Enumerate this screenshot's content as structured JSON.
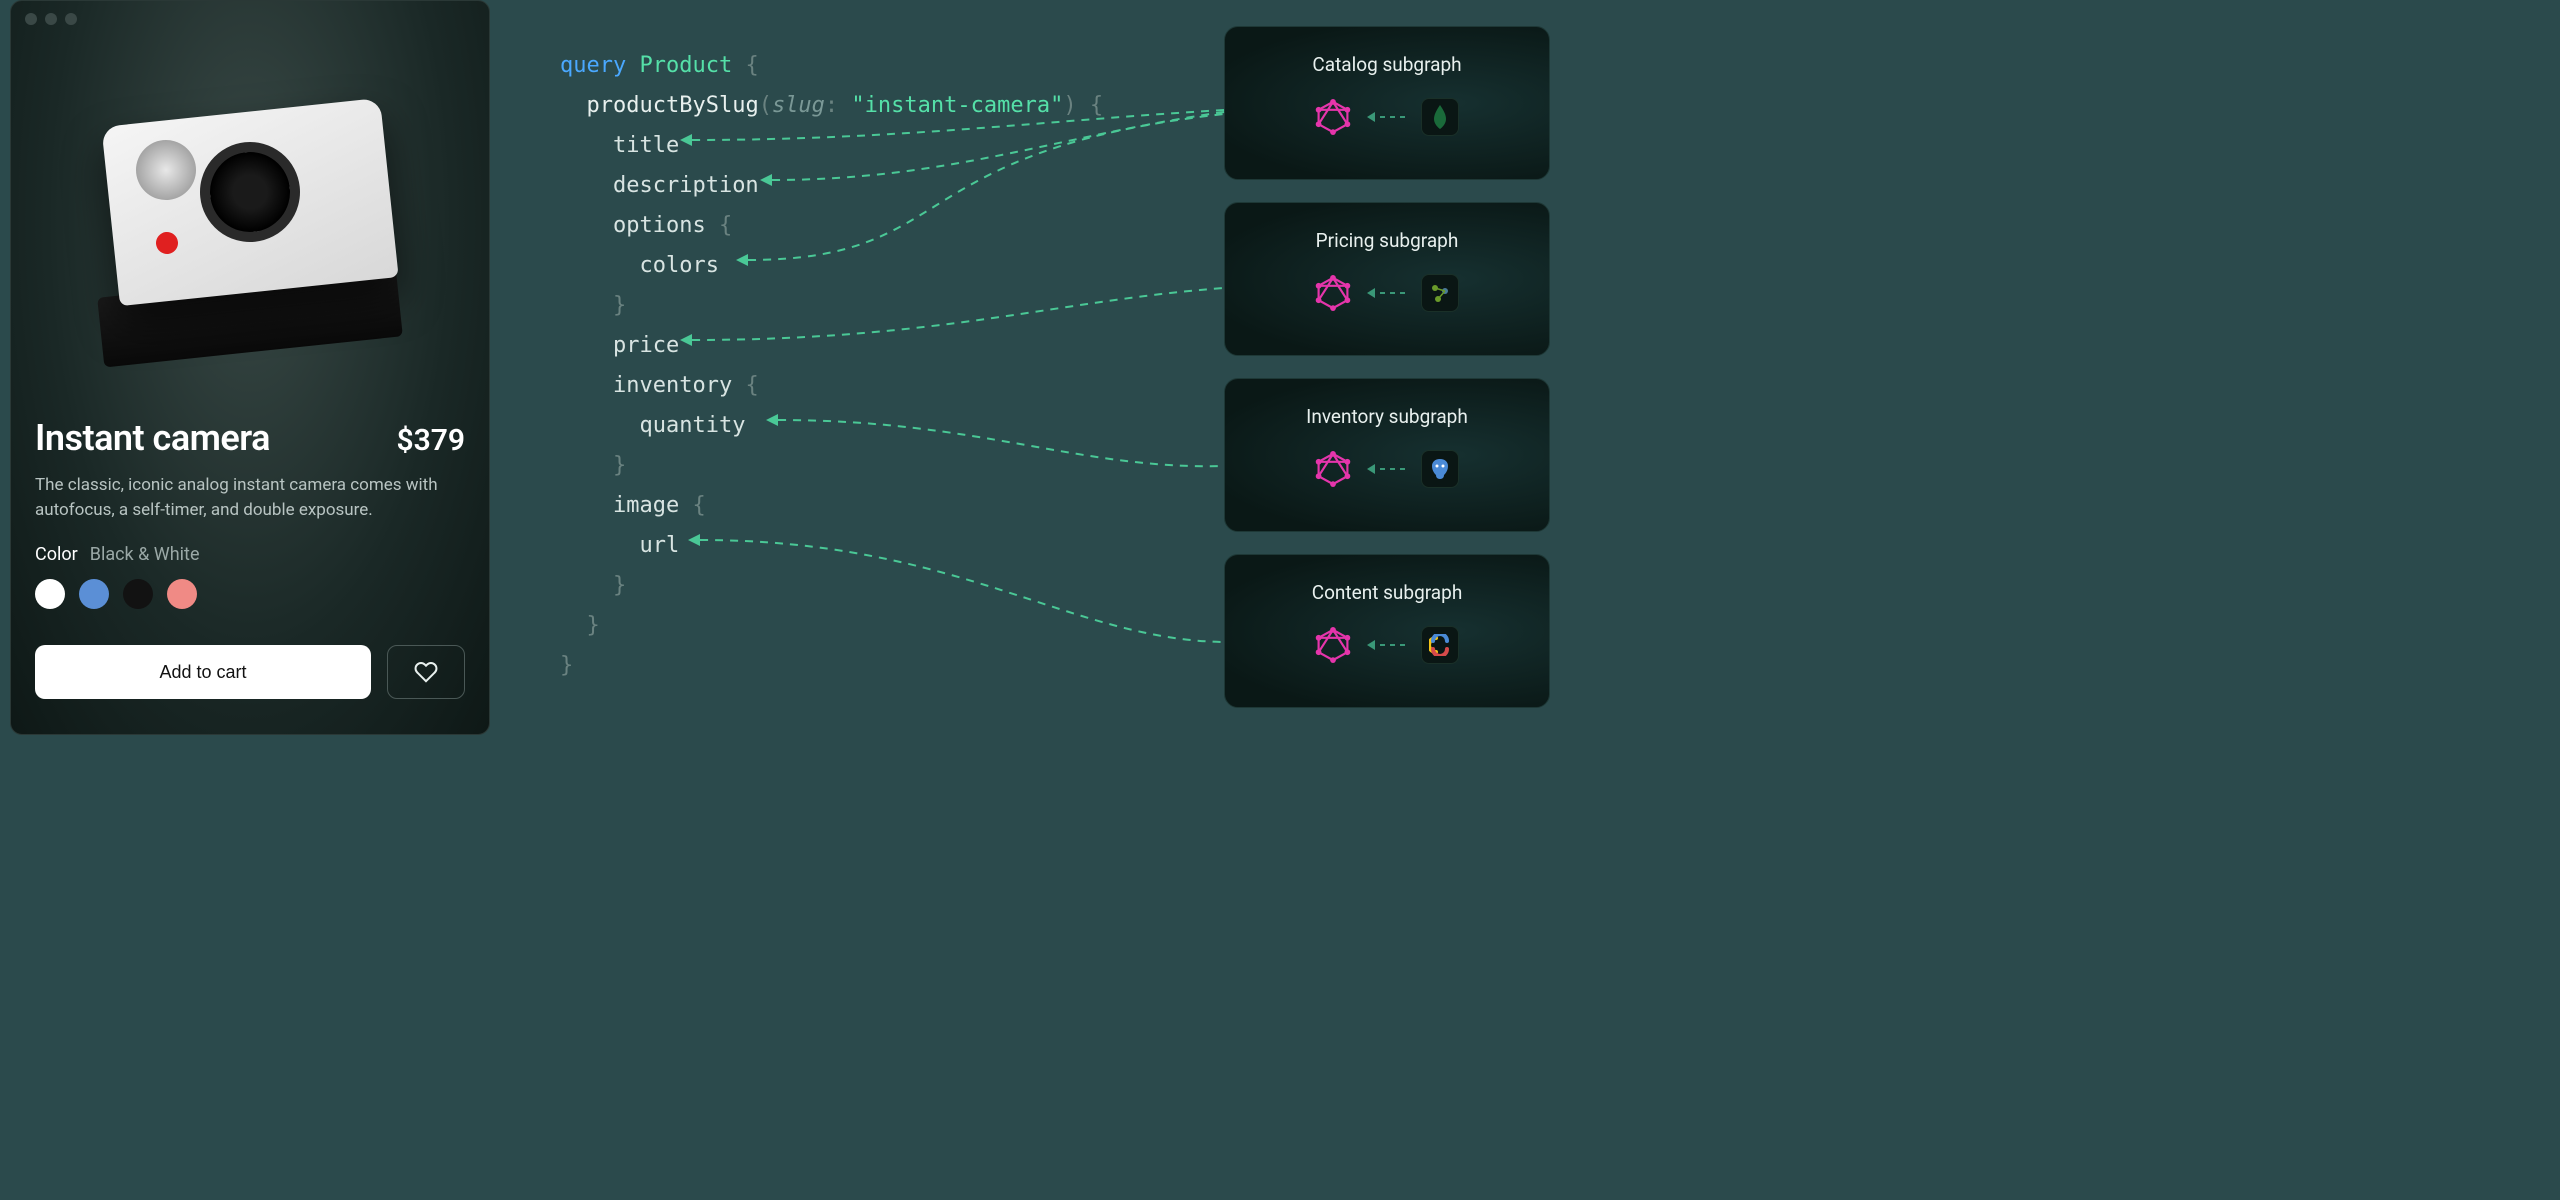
{
  "product": {
    "title": "Instant camera",
    "price": "$379",
    "description": "The classic, iconic analog instant camera comes with autofocus, a self-timer, and double exposure.",
    "color_label": "Color",
    "selected_color_name": "Black & White",
    "swatches": [
      {
        "name": "White",
        "hex": "#ffffff",
        "selected": true
      },
      {
        "name": "Blue",
        "hex": "#5b8fd6",
        "selected": false
      },
      {
        "name": "Black",
        "hex": "#121212",
        "selected": false
      },
      {
        "name": "Coral",
        "hex": "#f08a85",
        "selected": false
      }
    ],
    "cart_label": "Add to cart"
  },
  "query": {
    "keyword": "query",
    "operation": "Product",
    "root_field": "productBySlug",
    "arg_name": "slug",
    "arg_value": "\"instant-camera\"",
    "fields": {
      "title": "title",
      "description": "description",
      "options": "options",
      "colors": "colors",
      "price": "price",
      "inventory": "inventory",
      "quantity": "quantity",
      "image": "image",
      "url": "url"
    }
  },
  "subgraphs": [
    {
      "title": "Catalog subgraph",
      "db": "mongodb",
      "db_color": "#1a6a3a"
    },
    {
      "title": "Pricing subgraph",
      "db": "neo4j",
      "db_color": "#6a9a2a"
    },
    {
      "title": "Inventory subgraph",
      "db": "postgres",
      "db_color": "#4a8ad6"
    },
    {
      "title": "Content subgraph",
      "db": "contentful",
      "db_color": "#d64a4a"
    }
  ],
  "colors": {
    "accent_green": "#4ac896",
    "accent_pink": "#e535ab",
    "code_kw_blue": "#4aa8ff"
  }
}
